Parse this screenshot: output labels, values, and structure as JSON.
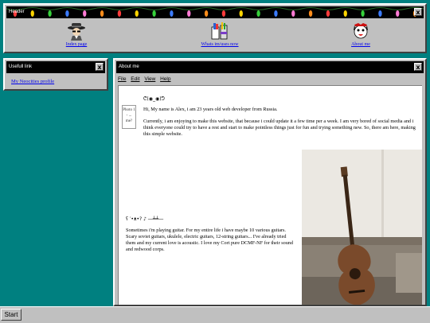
{
  "header": {
    "title": "Header",
    "close_label": "x",
    "nav": [
      {
        "label": "Index page",
        "icon": "spy-icon"
      },
      {
        "label": "Whats im/uses now",
        "icon": "paint-bucket-icon"
      },
      {
        "label": "About me",
        "icon": "cat-icon"
      }
    ]
  },
  "links": {
    "title": "Usefull link",
    "close_label": "x",
    "items": [
      {
        "label": "My Neocities profile"
      }
    ]
  },
  "about": {
    "title": "About me",
    "close_label": "x",
    "menu": [
      "File",
      "Edit",
      "View",
      "Help"
    ],
    "kaomoji_top": "ᕦ(◉_◉)ᕤ",
    "photo_alt": "Photo 1 - ... me?",
    "intro": "Hi, My name is Alex, i am 23 years old web developer from Russia.",
    "paragraph1": "Currently, i am enjoying to make this website, that because i could update it a few time per a week. I am very bored of social media and i think everyone could try to have a rest and start to make pointless things just for fun and trying something new. So, there am here, making this simple website.",
    "kaomoji_guitar": "ʕ ′•ᴥ•? ♪ ―┷┷―",
    "paragraph2": "Sometimes i'm playing guitar. For my entire life i have maybe 10 various guitars. Scary soviet guitars, ukulele, electric guitars, 12-string guitars... I've already tried them and my current love is acoustic. I love my Cort pure DCMF-NF for their sound and redwood corps."
  },
  "taskbar": {
    "start_label": "Start"
  }
}
